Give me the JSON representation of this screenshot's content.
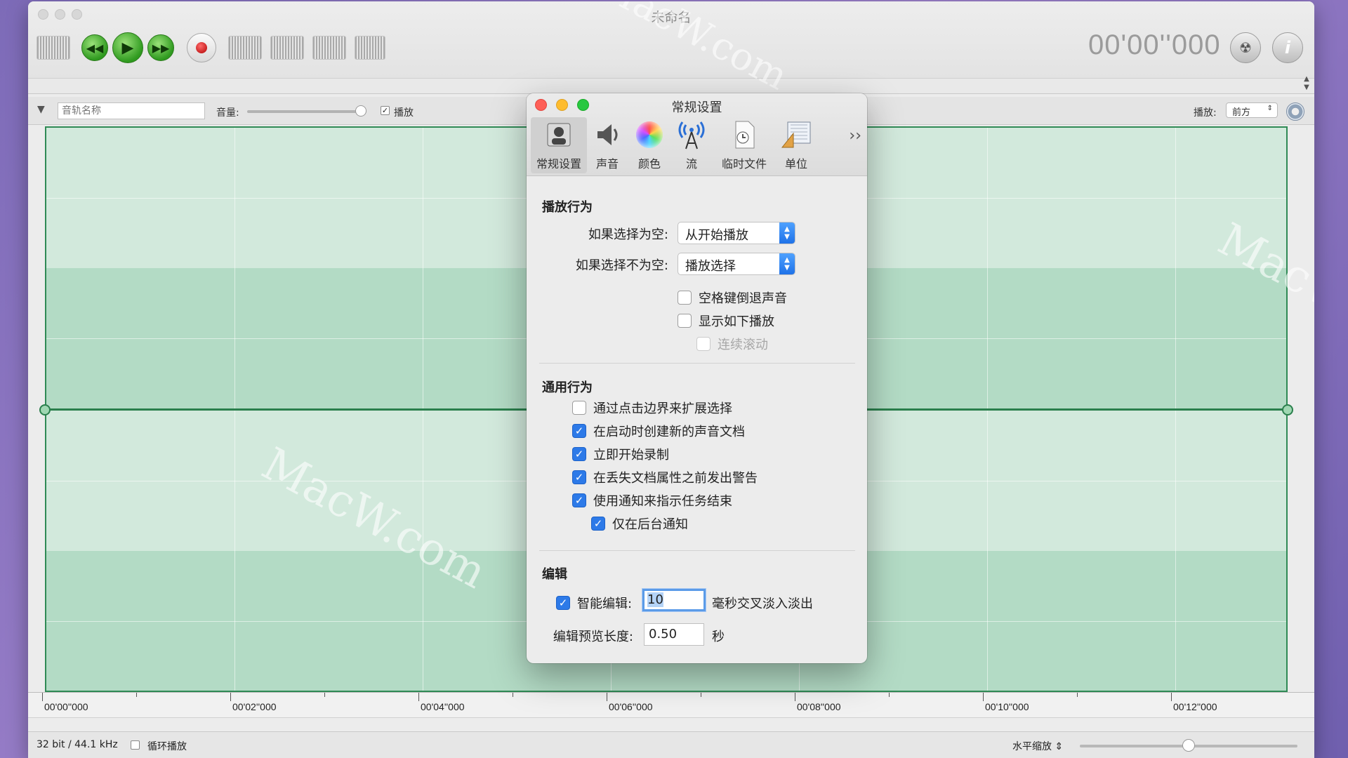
{
  "window": {
    "title": "未命名",
    "time": "00'00''000",
    "toolbar_icons": [
      "waveform-icon",
      "rewind-icon",
      "play-icon",
      "fast-forward-icon",
      "record-icon",
      "trim-icon",
      "silence-icon",
      "fade-icon",
      "insert-icon",
      "burn-icon",
      "info-icon"
    ]
  },
  "track": {
    "name_placeholder": "音轨名称",
    "volume_label": "音量:",
    "volume_level": 0.95,
    "play_checked": true,
    "play_label": "播放",
    "pan_label": "播放:",
    "pan_value": "前方"
  },
  "ruler": {
    "labels": [
      "00'00''000",
      "00'02''000",
      "00'04''000",
      "00'06''000",
      "00'08''000",
      "00'10''000",
      "00'12''000"
    ]
  },
  "status": {
    "format": "32 bit / 44.1 kHz",
    "loop_label": "循环播放",
    "loop_checked": false,
    "zoom_label": "水平缩放",
    "zoom_level": 0.5
  },
  "watermark": "MacW.com",
  "prefs": {
    "title": "常规设置",
    "tabs": [
      {
        "label": "常规设置",
        "icon": "general-icon",
        "active": true
      },
      {
        "label": "声音",
        "icon": "speaker-icon",
        "active": false
      },
      {
        "label": "颜色",
        "icon": "color-wheel-icon",
        "active": false
      },
      {
        "label": "流",
        "icon": "antenna-icon",
        "active": false
      },
      {
        "label": "临时文件",
        "icon": "temp-file-icon",
        "active": false
      },
      {
        "label": "单位",
        "icon": "units-icon",
        "active": false
      }
    ],
    "playback": {
      "title": "播放行为",
      "empty_label": "如果选择为空:",
      "empty_value": "从开始播放",
      "nonempty_label": "如果选择不为空:",
      "nonempty_value": "播放选择",
      "space_rewind": {
        "label": "空格键倒退声音",
        "checked": false
      },
      "show_playhead": {
        "label": "显示如下播放",
        "checked": false
      },
      "continuous_scroll": {
        "label": "连续滚动",
        "checked": false,
        "disabled": true
      }
    },
    "general": {
      "title": "通用行为",
      "items": [
        {
          "label": "通过点击边界来扩展选择",
          "checked": false
        },
        {
          "label": "在启动时创建新的声音文档",
          "checked": true
        },
        {
          "label": "立即开始录制",
          "checked": true
        },
        {
          "label": "在丢失文档属性之前发出警告",
          "checked": true
        },
        {
          "label": "使用通知来指示任务结束",
          "checked": true
        },
        {
          "label": "仅在后台通知",
          "checked": true
        }
      ]
    },
    "edit": {
      "title": "编辑",
      "smart_label": "智能编辑:",
      "smart_checked": true,
      "smart_value": "10",
      "smart_suffix": "毫秒交叉淡入淡出",
      "preview_label": "编辑预览长度:",
      "preview_value": "0.50",
      "preview_suffix": "秒"
    }
  }
}
